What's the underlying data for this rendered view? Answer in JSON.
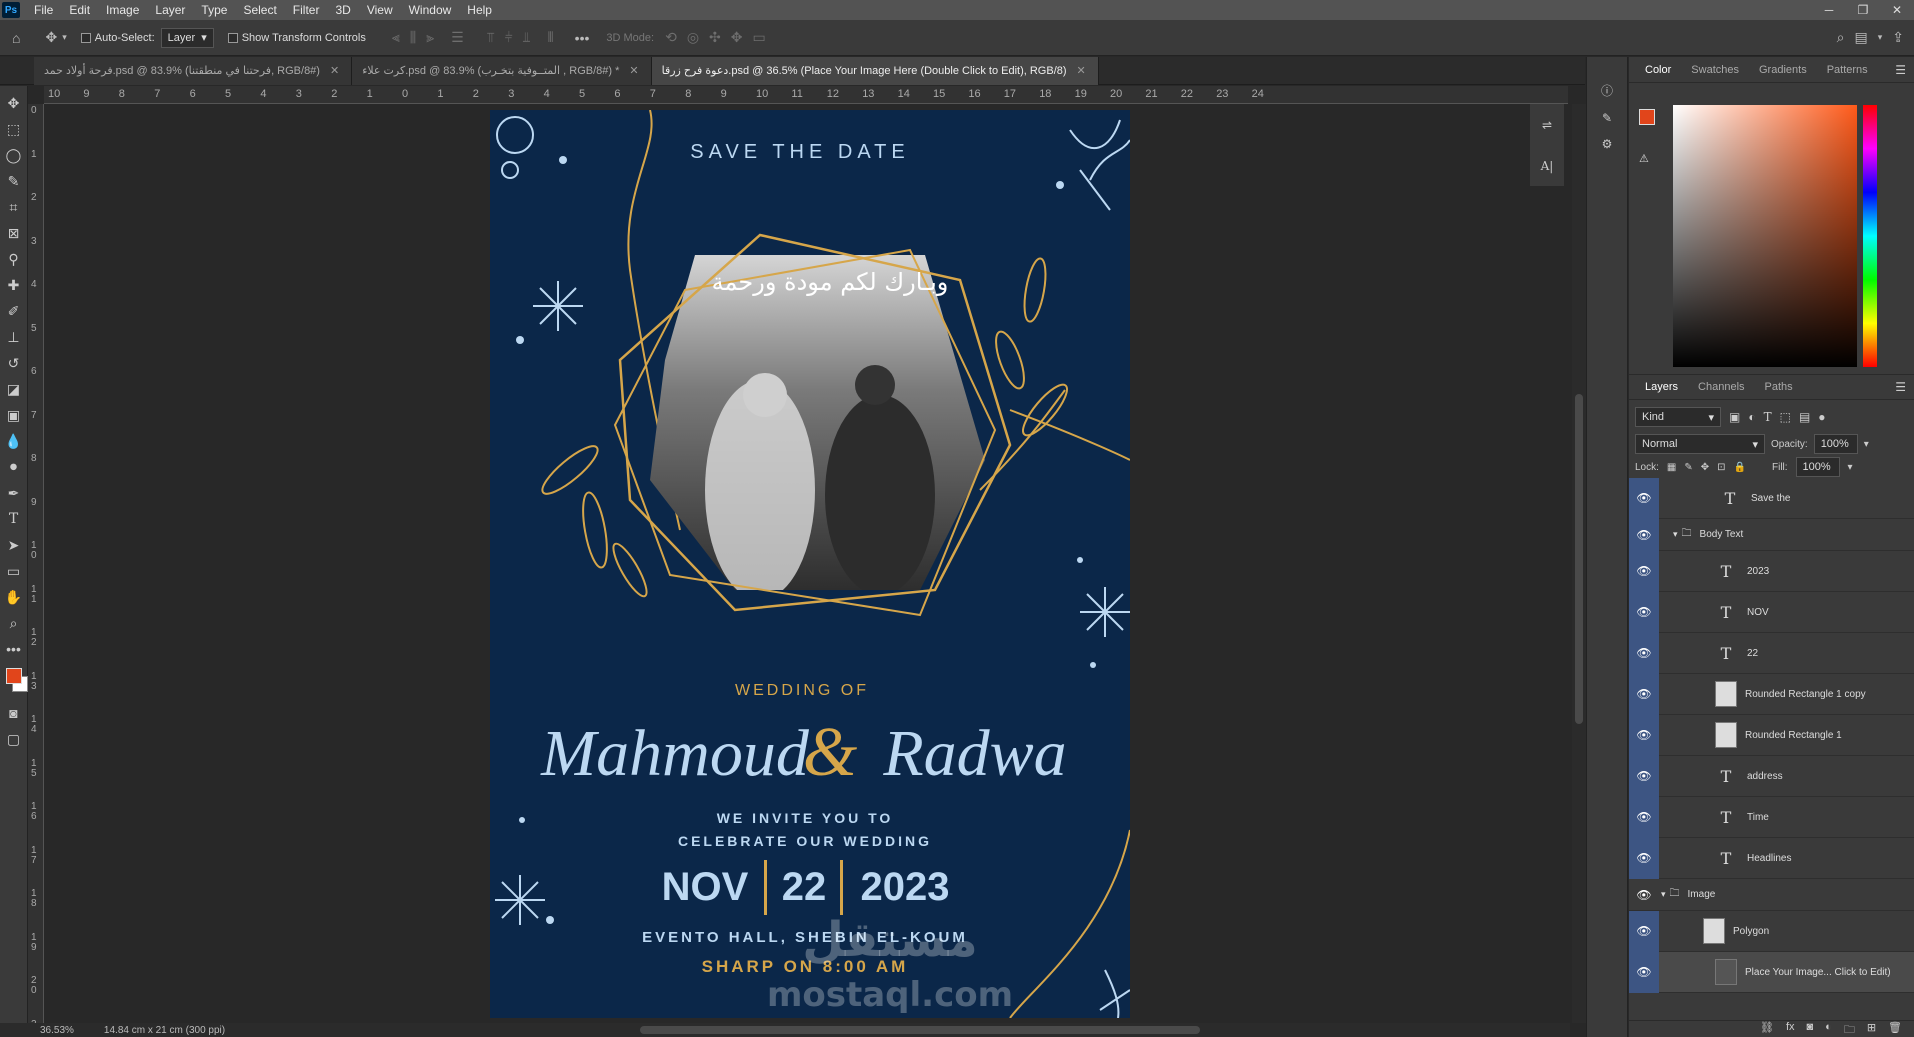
{
  "menu": [
    "File",
    "Edit",
    "Image",
    "Layer",
    "Type",
    "Select",
    "Filter",
    "3D",
    "View",
    "Window",
    "Help"
  ],
  "options": {
    "auto_select": "Auto-Select:",
    "auto_select_value": "Layer",
    "show_transform": "Show Transform Controls",
    "mode_3d": "3D Mode:"
  },
  "tabs": [
    {
      "label": "فرحة أولاد حمد.psd @ 83.9% (فرحتنا في منطقتنا, RGB/8#)",
      "active": false
    },
    {
      "label": "كرت علاء.psd @ 83.9% (المتــوفية بتخـرب , RGB/8#) *",
      "active": false
    },
    {
      "label": "دعوة فرح زرقا.psd @ 36.5% (Place Your Image Here (Double Click to Edit), RGB/8)",
      "active": true
    }
  ],
  "ruler_h": [
    "10",
    "9",
    "8",
    "7",
    "6",
    "5",
    "4",
    "3",
    "2",
    "1",
    "0",
    "1",
    "2",
    "3",
    "4",
    "5",
    "6",
    "7",
    "8",
    "9",
    "10",
    "11",
    "12",
    "13",
    "14",
    "15",
    "16",
    "17",
    "18",
    "19",
    "20",
    "21",
    "22",
    "23",
    "24"
  ],
  "ruler_v": [
    "0",
    "1",
    "2",
    "3",
    "4",
    "5",
    "6",
    "7",
    "8",
    "9",
    "1 0",
    "1 1",
    "1 2",
    "1 3",
    "1 4",
    "1 5",
    "1 6",
    "1 7",
    "1 8",
    "1 9",
    "2 0",
    "2 1"
  ],
  "status": {
    "zoom": "36.53%",
    "doc_size": "14.84 cm x 21 cm (300 ppi)"
  },
  "document": {
    "save_the_date": "SAVE THE DATE",
    "arabic_caption": "وبـارك لكم مودة ورحمة",
    "wedding_of": "WEDDING OF",
    "groom": "Mahmoud",
    "amp": "&",
    "bride": "Radwa",
    "invite_line1": "WE INVITE YOU TO",
    "invite_line2": "CELEBRATE OUR WEDDING",
    "month": "NOV",
    "day": "22",
    "year": "2023",
    "address": "EVENTO HALL, SHEBIN EL-KOUM",
    "time": "SHARP ON 8:00 AM",
    "watermark_ar": "مستقل",
    "watermark_en": "mostaql.com",
    "colors": {
      "background": "#0b2749",
      "gold": "#d6a64a",
      "light_blue": "#bcd8f2"
    }
  },
  "color_panel": {
    "tabs": [
      "Color",
      "Swatches",
      "Gradients",
      "Patterns"
    ],
    "fg": "#e1451b",
    "bg": "#ffffff"
  },
  "layers_panel": {
    "tabs": [
      "Layers",
      "Channels",
      "Paths"
    ],
    "kind": "Kind",
    "blend": "Normal",
    "opacity_label": "Opacity:",
    "opacity": "100%",
    "lock_label": "Lock:",
    "fill_label": "Fill:",
    "fill": "100%",
    "layers": [
      {
        "name": "Save the",
        "type": "text",
        "indent": 2
      },
      {
        "name": "Body Text",
        "type": "group",
        "indent": 1
      },
      {
        "name": "2023",
        "type": "text",
        "indent": 2
      },
      {
        "name": "NOV",
        "type": "text",
        "indent": 2
      },
      {
        "name": "22",
        "type": "text",
        "indent": 2
      },
      {
        "name": "Rounded Rectangle 1 copy",
        "type": "shape",
        "indent": 2
      },
      {
        "name": "Rounded Rectangle 1",
        "type": "shape",
        "indent": 2
      },
      {
        "name": "address",
        "type": "text",
        "indent": 2
      },
      {
        "name": "Time",
        "type": "text",
        "indent": 2
      },
      {
        "name": "Headlines",
        "type": "text",
        "indent": 2
      },
      {
        "name": "Image",
        "type": "group",
        "indent": 0
      },
      {
        "name": "Polygon",
        "type": "shape",
        "indent": 1
      },
      {
        "name": "Place Your Image... Click to Edit)",
        "type": "smart",
        "indent": 1
      }
    ]
  }
}
